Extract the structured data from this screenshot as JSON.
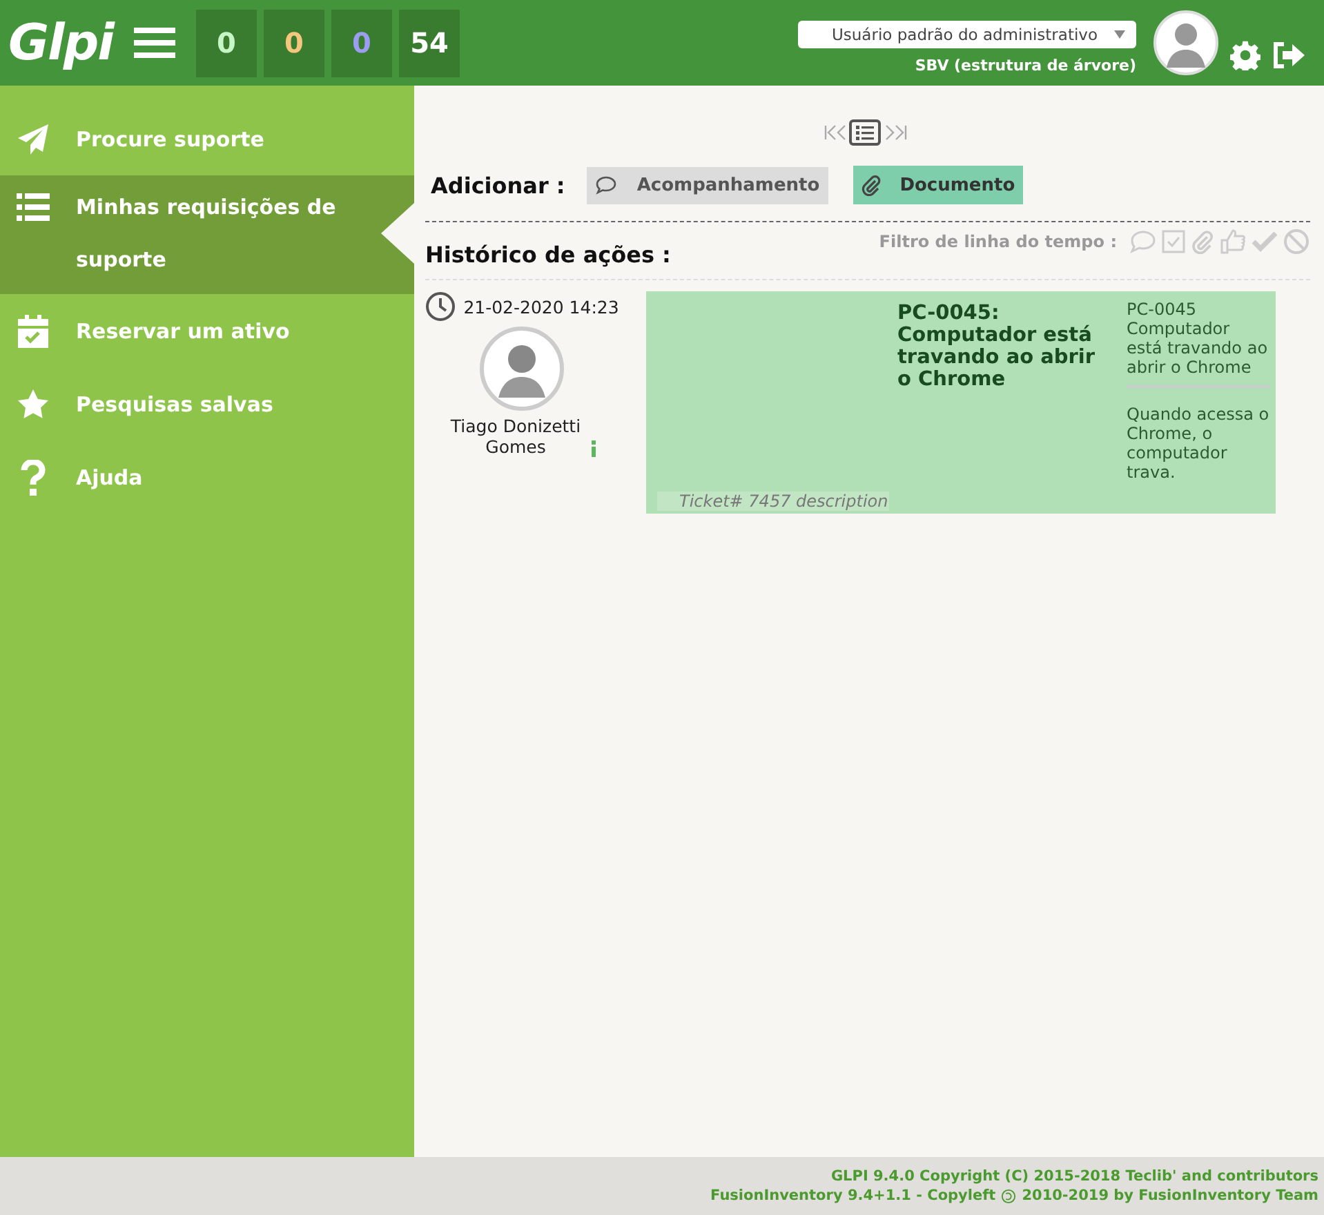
{
  "header": {
    "logo": "Glpi",
    "counters": [
      {
        "value": "0",
        "color": "#c6f6c6"
      },
      {
        "value": "0",
        "color": "#f5c77e"
      },
      {
        "value": "0",
        "color": "#9c9cf0"
      },
      {
        "value": "54",
        "color": "#ffffff"
      }
    ],
    "profile": "Usuário padrão do administrativo",
    "entity": "SBV (estrutura de árvore)"
  },
  "sidebar": {
    "items": [
      {
        "label": "Procure suporte",
        "kind": "plane",
        "selected": false
      },
      {
        "label": "Minhas requisições de suporte",
        "kind": "list",
        "selected": true
      },
      {
        "label": "Reservar um ativo",
        "kind": "calendar",
        "selected": false
      },
      {
        "label": "Pesquisas salvas",
        "kind": "star",
        "selected": false
      },
      {
        "label": "Ajuda",
        "kind": "question",
        "selected": false
      }
    ]
  },
  "main": {
    "add_label": "Adicionar :",
    "add_buttons": [
      {
        "label": "Acompanhamento",
        "kind": "followup"
      },
      {
        "label": "Documento",
        "kind": "document"
      }
    ],
    "history_title": "Histórico de ações :",
    "filter_label": "Filtro de linha do tempo :",
    "entry": {
      "date": "21-02-2020 14:23",
      "author": "Tiago Donizetti Gomes",
      "title": "PC-0045: Computador está travando ao abrir o Chrome",
      "side_title": "PC-0045 Computador está travando ao abrir o Chrome",
      "side_text": "Quando acessa o Chrome, o computador trava.",
      "caption": "Ticket# 7457 description"
    }
  },
  "footer": {
    "line1": "GLPI 9.4.0 Copyright (C) 2015-2018 Teclib' and contributors",
    "line2_before": "FusionInventory 9.4+1.1 - Copyleft",
    "line2_after": "2010-2019 by FusionInventory Team"
  }
}
